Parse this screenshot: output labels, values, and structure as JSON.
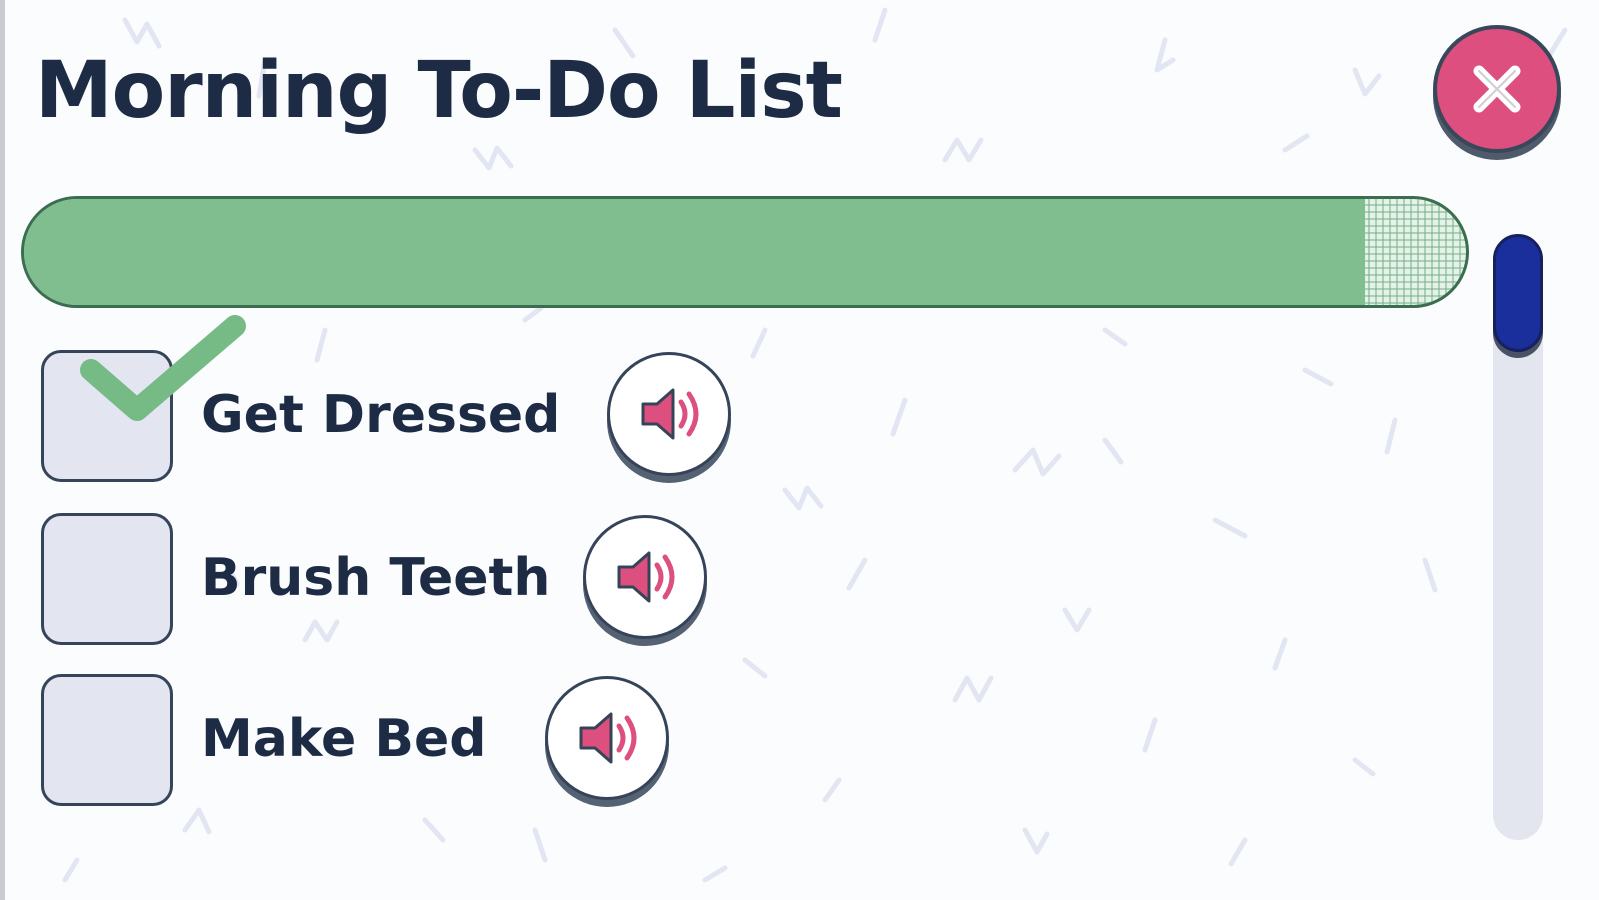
{
  "title": "Morning To-Do List",
  "close_icon": "close-icon",
  "progress": {
    "fraction": 0.93,
    "fill_color": "#80bd8f"
  },
  "tasks": [
    {
      "label": "Get Dressed",
      "checked": true,
      "speaker_icon": "speaker-icon"
    },
    {
      "label": "Brush Teeth",
      "checked": false,
      "speaker_icon": "speaker-icon"
    },
    {
      "label": "Make Bed",
      "checked": false,
      "speaker_icon": "speaker-icon"
    }
  ],
  "colors": {
    "accent_pink": "#dc4f7e",
    "check_green": "#76bb86",
    "title_navy": "#1d2b45",
    "scroll_blue": "#1a2f9c"
  }
}
